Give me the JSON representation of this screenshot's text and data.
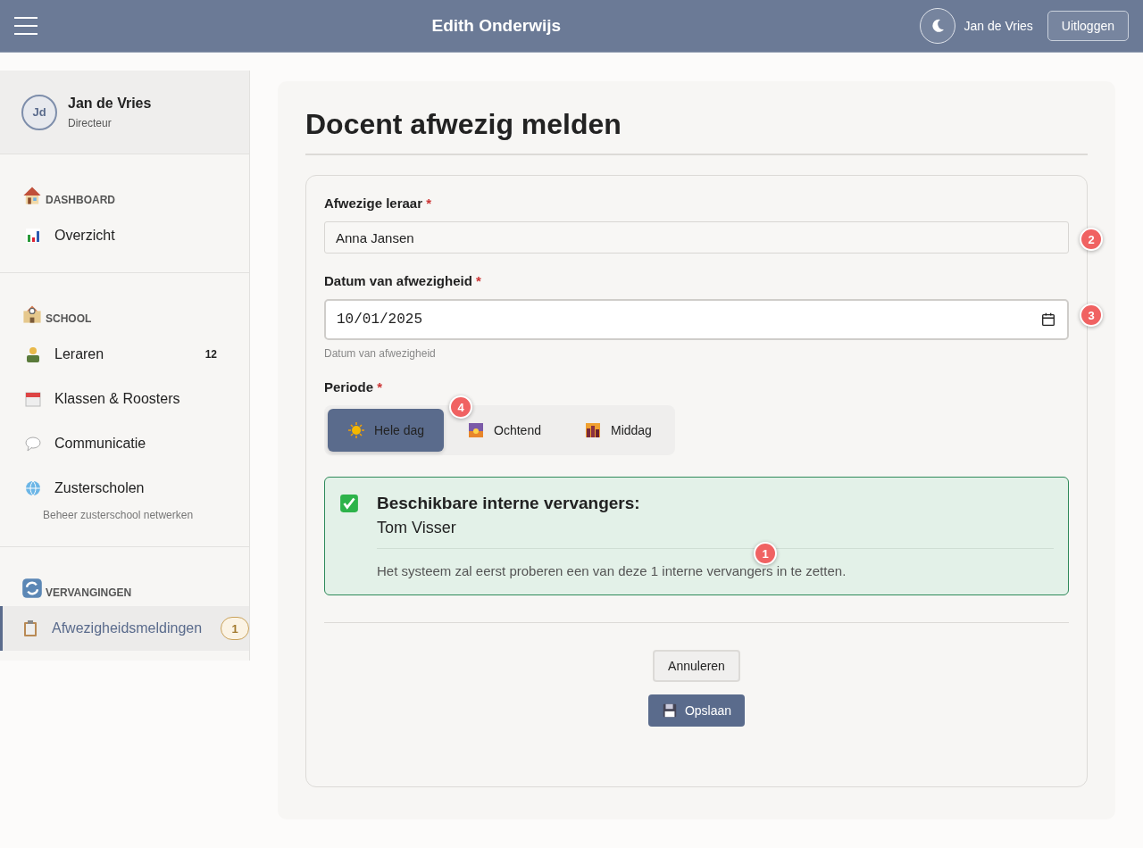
{
  "header": {
    "title": "Edith Onderwijs",
    "user": "Jan de Vries",
    "logout": "Uitloggen"
  },
  "sidebar": {
    "user": {
      "initials": "Jd",
      "name": "Jan de Vries",
      "role": "Directeur"
    },
    "sections": [
      {
        "title": "DASHBOARD",
        "items": [
          {
            "label": "Overzicht",
            "selected": false
          }
        ]
      },
      {
        "title": "SCHOOL",
        "items": [
          {
            "label": "Leraren",
            "count": "12",
            "selected": false
          },
          {
            "label": "Klassen & Roosters",
            "selected": false
          },
          {
            "label": "Communicatie",
            "selected": false
          },
          {
            "label": "Zusterscholen",
            "hint": "Beheer zusterschool netwerken",
            "selected": false
          }
        ]
      },
      {
        "title": "VERVANGINGEN",
        "items": [
          {
            "label": "Afwezigheidsmeldingen",
            "badge": "1",
            "selected": true
          }
        ]
      }
    ]
  },
  "page": {
    "title": "Docent afwezig melden",
    "teacher": {
      "label": "Afwezige leraar",
      "required": "*",
      "value": "Anna Jansen",
      "marker": "2"
    },
    "date": {
      "label": "Datum van afwezigheid",
      "required": "*",
      "value": "10/01/2025",
      "help": "Datum van afwezigheid",
      "marker": "3"
    },
    "period": {
      "label": "Periode",
      "required": "*",
      "marker": "4",
      "options": [
        {
          "label": "Hele dag",
          "selected": true
        },
        {
          "label": "Ochtend",
          "selected": false
        },
        {
          "label": "Middag",
          "selected": false
        }
      ]
    },
    "alert": {
      "title": "Beschikbare interne vervangers:",
      "names": "Tom Visser",
      "note": "Het systeem zal eerst proberen een van deze 1 interne vervangers in te zetten.",
      "marker": "1"
    },
    "buttons": {
      "cancel": "Annuleren",
      "save": "Opslaan"
    }
  }
}
